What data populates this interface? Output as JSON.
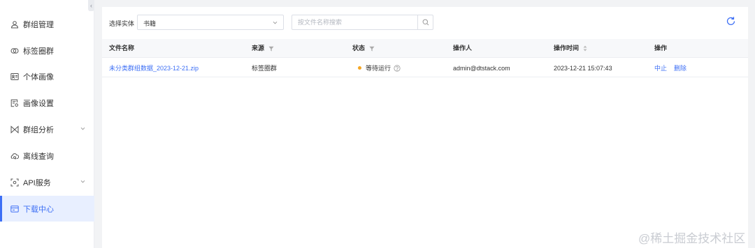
{
  "sidebar": {
    "items": [
      {
        "label": "群组管理",
        "icon": "group-icon",
        "has_chevron": false,
        "active": false
      },
      {
        "label": "标签圈群",
        "icon": "tag-circle-icon",
        "has_chevron": false,
        "active": false
      },
      {
        "label": "个体画像",
        "icon": "profile-card-icon",
        "has_chevron": false,
        "active": false
      },
      {
        "label": "画像设置",
        "icon": "profile-settings-icon",
        "has_chevron": false,
        "active": false
      },
      {
        "label": "群组分析",
        "icon": "bowtie-icon",
        "has_chevron": true,
        "active": false
      },
      {
        "label": "离线查询",
        "icon": "cloud-query-icon",
        "has_chevron": false,
        "active": false
      },
      {
        "label": "API服务",
        "icon": "api-icon",
        "has_chevron": true,
        "active": false
      },
      {
        "label": "下载中心",
        "icon": "download-center-icon",
        "has_chevron": false,
        "active": true
      }
    ]
  },
  "filters": {
    "entity_label": "选择实体",
    "entity_value": "书籍",
    "search_placeholder": "按文件名称搜索"
  },
  "table": {
    "columns": [
      {
        "label": "文件名称",
        "filterable": false,
        "sortable": false
      },
      {
        "label": "来源",
        "filterable": true,
        "sortable": false
      },
      {
        "label": "状态",
        "filterable": true,
        "sortable": false
      },
      {
        "label": "操作人",
        "filterable": false,
        "sortable": false
      },
      {
        "label": "操作时间",
        "filterable": false,
        "sortable": true
      },
      {
        "label": "操作",
        "filterable": false,
        "sortable": false
      }
    ],
    "rows": [
      {
        "file_name": "未分类群组数据_2023-12-21.zip",
        "source": "标签圈群",
        "status": "等待运行",
        "operator": "admin@dtstack.com",
        "time": "2023-12-21 15:07:43",
        "actions": [
          "中止",
          "删除"
        ]
      }
    ]
  },
  "watermark": "@稀土掘金技术社区",
  "colors": {
    "accent": "#3d6ff5",
    "status_waiting": "#f5a623",
    "active_bg": "#e8efff"
  }
}
